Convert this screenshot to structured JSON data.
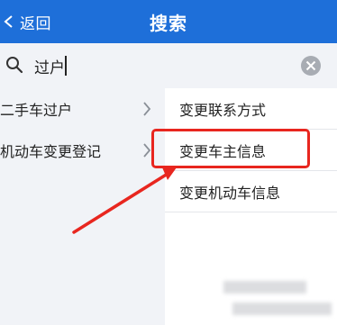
{
  "header": {
    "back_label": "返回",
    "title": "搜索"
  },
  "search": {
    "value": "过户",
    "icons": {
      "search": "search-icon",
      "clear": "clear-icon"
    }
  },
  "categories": [
    {
      "label": "二手车过户",
      "icon": "chevron-right-icon"
    },
    {
      "label": "机动车变更登记",
      "icon": "chevron-right-icon"
    }
  ],
  "results": [
    {
      "label": "变更联系方式"
    },
    {
      "label": "变更车主信息"
    },
    {
      "label": "变更机动车信息"
    }
  ],
  "colors": {
    "header_bg": "#1e6fd9",
    "highlight": "#e8261f",
    "panel_bg": "#f1f3f7"
  }
}
